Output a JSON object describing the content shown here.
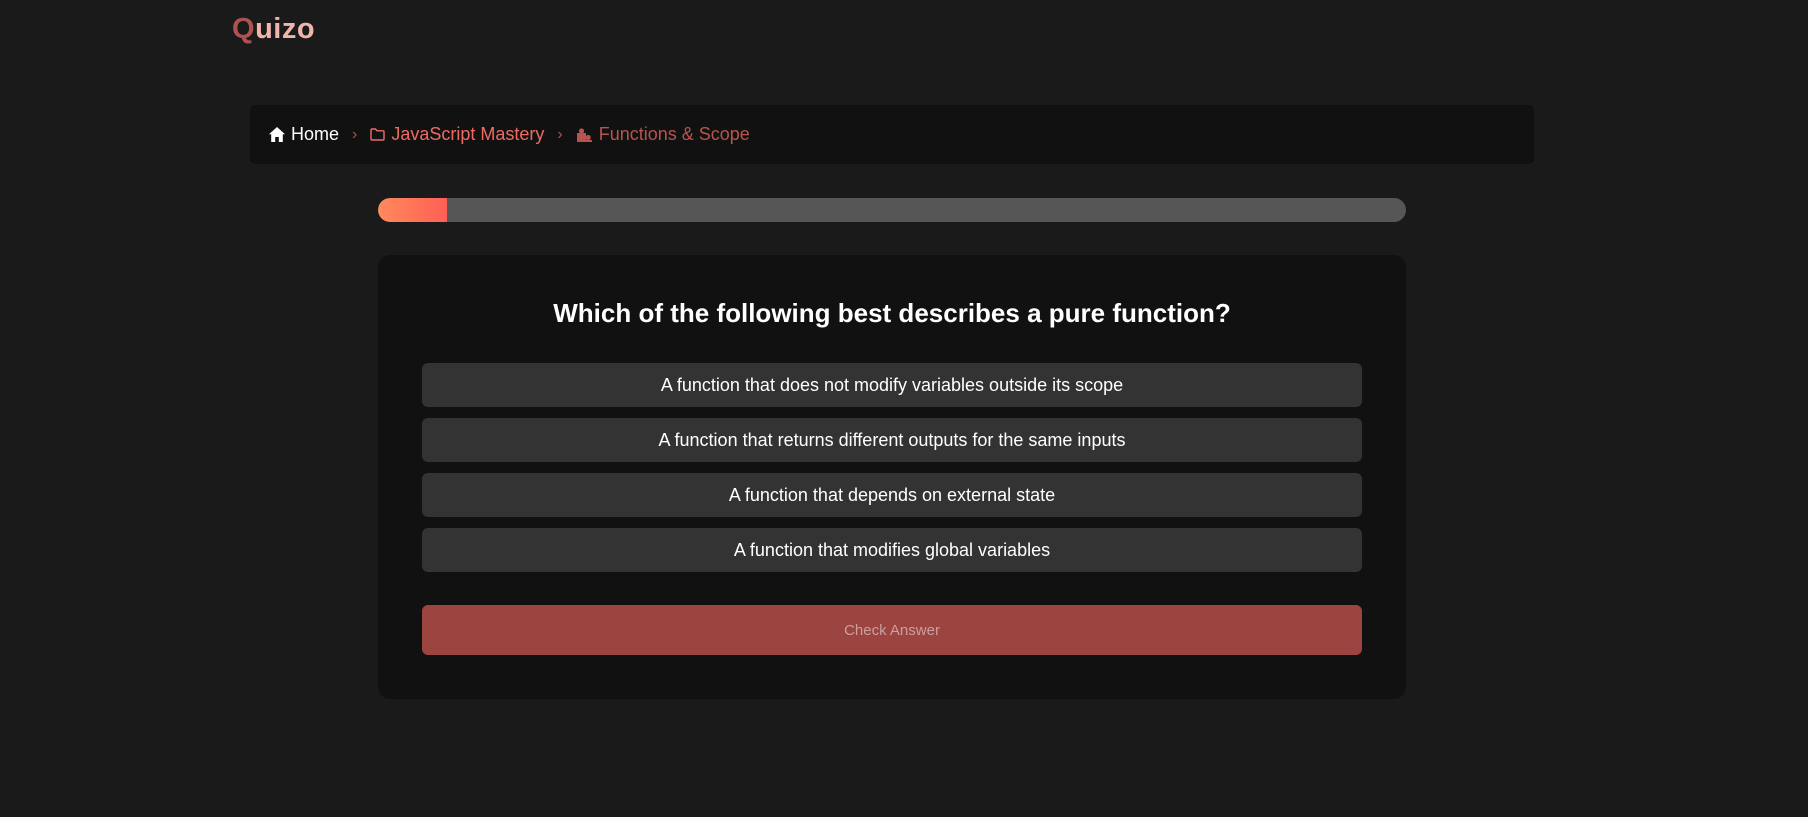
{
  "brand": {
    "logo_first": "Q",
    "logo_rest": "uizo"
  },
  "breadcrumb": {
    "home_label": "Home",
    "course_label": "JavaScript Mastery",
    "current_label": "Functions & Scope",
    "separator": "›"
  },
  "progress": {
    "fraction": 0.067
  },
  "quiz": {
    "question": "Which of the following best describes a pure function?",
    "options": [
      "A function that does not modify variables outside its scope",
      "A function that returns different outputs for the same inputs",
      "A function that depends on external state",
      "A function that modifies global variables"
    ],
    "check_label": "Check Answer"
  },
  "icons": {
    "home": "home-icon",
    "course": "folder-icon",
    "current": "puzzle-icon"
  },
  "colors": {
    "background": "#1a1a1a",
    "card": "#111111",
    "accent": "#ff5f56",
    "option_bg": "#333333",
    "button_disabled": "#9b4440"
  }
}
